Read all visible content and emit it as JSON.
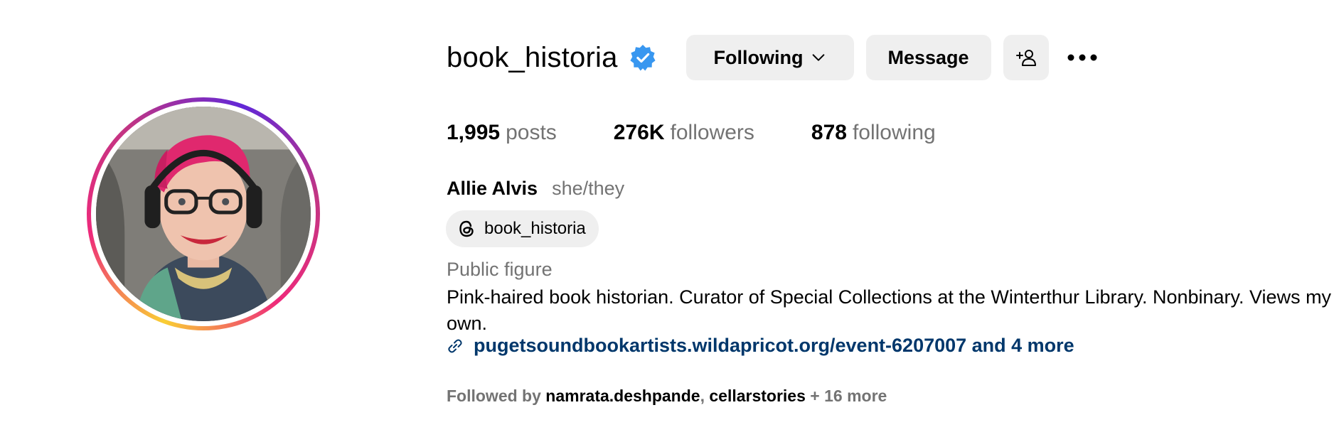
{
  "profile": {
    "username": "book_historia",
    "verified": true,
    "name": "Allie Alvis",
    "pronouns": "she/they",
    "threads_handle": "book_historia",
    "category": "Public figure",
    "bio": "Pink-haired book historian. Curator of Special Collections at the Winterthur Library. Nonbinary. Views my own.",
    "link": "pugetsoundbookartists.wildapricot.org/event-6207007 and 4 more"
  },
  "actions": {
    "following_label": "Following",
    "message_label": "Message"
  },
  "stats": {
    "posts_count": "1,995",
    "posts_label": "posts",
    "followers_count": "276K",
    "followers_label": "followers",
    "following_count": "878",
    "following_label": "following"
  },
  "followed_by": {
    "prefix": "Followed by",
    "account_1": "namrata.deshpande",
    "separator": ",",
    "account_2": "cellarstories",
    "suffix": "+ 16 more"
  },
  "colors": {
    "verified_blue": "#3897f0",
    "button_bg": "#efefef",
    "secondary_text": "#737373",
    "link_color": "#00376b"
  },
  "icons": {
    "verified": "verified-badge-icon",
    "chevron": "chevron-down-icon",
    "add_user": "add-user-icon",
    "more": "more-options-icon",
    "threads": "threads-icon",
    "link": "link-icon"
  }
}
